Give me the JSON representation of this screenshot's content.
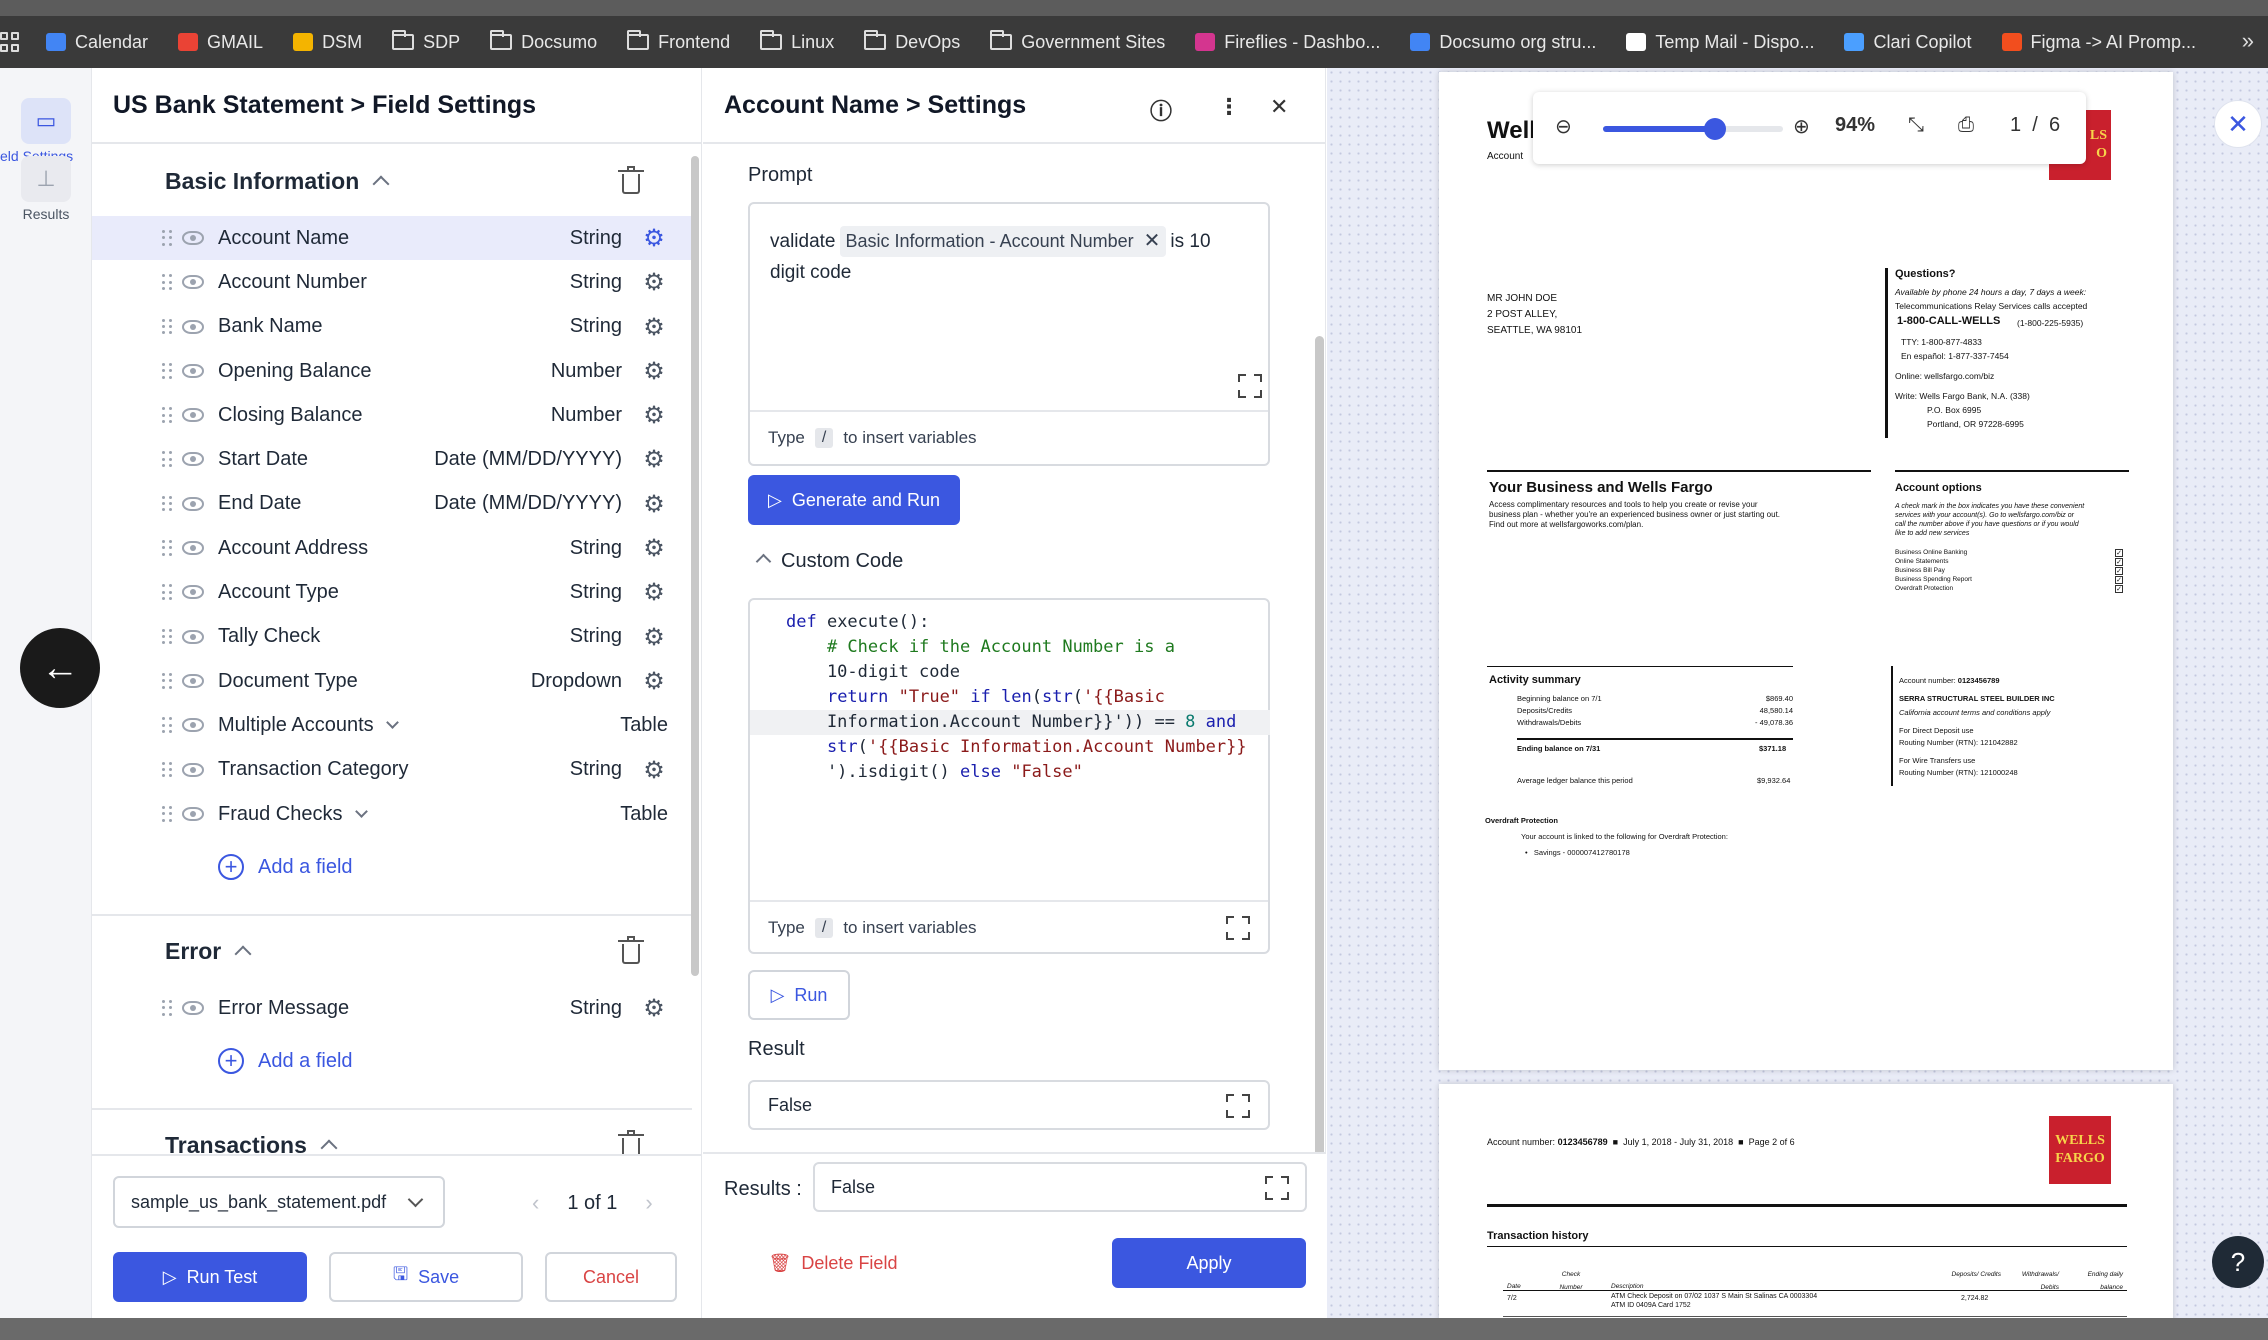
{
  "bookmarks": [
    {
      "label": "Calendar",
      "icon": "calendar-icon",
      "color": "#4285f4"
    },
    {
      "label": "GMAIL",
      "icon": "gmail-icon",
      "color": "#ea4335"
    },
    {
      "label": "DSM",
      "icon": "dsm-icon",
      "color": "#f4b400"
    },
    {
      "label": "SDP",
      "icon": "folder-icon"
    },
    {
      "label": "Docsumo",
      "icon": "folder-icon"
    },
    {
      "label": "Frontend",
      "icon": "folder-icon"
    },
    {
      "label": "Linux",
      "icon": "folder-icon"
    },
    {
      "label": "DevOps",
      "icon": "folder-icon"
    },
    {
      "label": "Government Sites",
      "icon": "folder-icon"
    },
    {
      "label": "Fireflies - Dashbo...",
      "icon": "fireflies-icon",
      "color": "#d4358f"
    },
    {
      "label": "Docsumo org stru...",
      "icon": "docs-icon",
      "color": "#4285f4"
    },
    {
      "label": "Temp Mail - Dispo...",
      "icon": "globe-icon",
      "color": "#ffffff"
    },
    {
      "label": "Clari Copilot",
      "icon": "clari-icon",
      "color": "#4b9fff"
    },
    {
      "label": "Figma -> AI Promp...",
      "icon": "figma-icon",
      "color": "#f24e1e"
    }
  ],
  "rail": {
    "field_settings_label": "eld Settings",
    "results_label": "Results"
  },
  "field_settings": {
    "title": "US Bank Statement > Field Settings",
    "groups": [
      {
        "title": "Basic Information",
        "fields": [
          {
            "name": "Account Name",
            "type": "String",
            "selected": true,
            "gear": true,
            "expandable": false
          },
          {
            "name": "Account Number",
            "type": "String",
            "gear": true,
            "expandable": false
          },
          {
            "name": "Bank Name",
            "type": "String",
            "gear": true,
            "expandable": false
          },
          {
            "name": "Opening Balance",
            "type": "Number",
            "gear": true,
            "expandable": false
          },
          {
            "name": "Closing Balance",
            "type": "Number",
            "gear": true,
            "expandable": false
          },
          {
            "name": "Start Date",
            "type": "Date (MM/DD/YYYY)",
            "gear": true,
            "expandable": false
          },
          {
            "name": "End Date",
            "type": "Date (MM/DD/YYYY)",
            "gear": true,
            "expandable": false
          },
          {
            "name": "Account Address",
            "type": "String",
            "gear": true,
            "expandable": false
          },
          {
            "name": "Account Type",
            "type": "String",
            "gear": true,
            "expandable": false
          },
          {
            "name": "Tally Check",
            "type": "String",
            "gear": true,
            "expandable": false
          },
          {
            "name": "Document Type",
            "type": "Dropdown",
            "gear": true,
            "expandable": false
          },
          {
            "name": "Multiple Accounts",
            "type": "Table",
            "gear": false,
            "expandable": true
          },
          {
            "name": "Transaction Category",
            "type": "String",
            "gear": true,
            "expandable": false
          },
          {
            "name": "Fraud Checks",
            "type": "Table",
            "gear": false,
            "expandable": true
          }
        ],
        "add_label": "Add a field"
      },
      {
        "title": "Error",
        "fields": [
          {
            "name": "Error Message",
            "type": "String",
            "gear": true,
            "expandable": false
          }
        ],
        "add_label": "Add a field"
      },
      {
        "title": "Transactions",
        "fields": [],
        "add_label": ""
      }
    ],
    "footer": {
      "file_name": "sample_us_bank_statement.pdf",
      "pager": "1 of 1",
      "run_test": "Run Test",
      "save": "Save",
      "cancel": "Cancel"
    }
  },
  "settings": {
    "title": "Account Name > Settings",
    "prompt_label": "Prompt",
    "prompt_before": "validate",
    "prompt_chip": "Basic Information - Account Number",
    "prompt_after_1": "is 10",
    "prompt_after_2": "digit code",
    "hint_type": "Type",
    "hint_key": "/",
    "hint_rest": "to insert variables",
    "generate_button": "Generate and Run",
    "custom_code_label": "Custom Code",
    "code_lines": [
      "def execute():",
      "    # Check if the Account Number is a",
      "    10-digit code",
      "    return \"True\" if len(str('{{Basic",
      "    Information.Account Number}}')) == 8 and",
      "    str('{{Basic Information.Account Number}}",
      "    ').isdigit() else \"False\""
    ],
    "run_button": "Run",
    "result_label": "Result",
    "result_value": "False",
    "results_label": "Results :",
    "results_value": "False",
    "delete_button": "Delete Field",
    "apply_button": "Apply"
  },
  "viewer": {
    "zoom": "94%",
    "page_current": "1",
    "page_sep": "/",
    "page_total": "6",
    "zoom_fraction": 0.62
  },
  "document": {
    "page1": {
      "brand_partial": "Well",
      "account_partial": "Account",
      "logo_partial_1": "LS",
      "logo_partial_2": "O",
      "address": [
        "MR JOHN DOE",
        "2 POST ALLEY,",
        "SEATTLE, WA 98101"
      ],
      "questions_title": "Questions?",
      "questions_lines": [
        "Available by phone 24 hours a day, 7 days a week:",
        "Telecommunications Relay Services calls accepted"
      ],
      "phone": "1-800-CALL-WELLS",
      "phone_alt": "(1-800-225-5935)",
      "tty": "TTY: 1-800-877-4833",
      "espanol": "En español: 1-877-337-7454",
      "online": "Online: wellsfargo.com/biz",
      "write": [
        "Write: Wells Fargo Bank, N.A. (338)",
        "P.O. Box 6995",
        "Portland, OR 97228-6995"
      ],
      "your_business_title": "Your Business and Wells Fargo",
      "your_business_text": [
        "Access complimentary resources and tools to help you create or revise your",
        "business plan - whether you're an experienced business owner or just starting out.",
        "Find out more at wellsfargoworks.com/plan."
      ],
      "account_options_title": "Account options",
      "account_options_text": [
        "A check mark in the box indicates you have these convenient",
        "services with your account(s). Go to wellsfargo.com/biz or",
        "call the number above if you have questions or if you would",
        "like to add new services"
      ],
      "account_options_items": [
        "Business Online Banking",
        "Online Statements",
        "Business Bill Pay",
        "Business Spending Report",
        "Overdraft Protection"
      ],
      "activity_title": "Activity summary",
      "activity_rows": [
        {
          "label": "Beginning balance on 7/1",
          "value": "$869.40"
        },
        {
          "label": "Deposits/Credits",
          "value": "48,580.14"
        },
        {
          "label": "Withdrawals/Debits",
          "value": "- 49,078.36"
        }
      ],
      "ending_label": "Ending balance on 7/31",
      "ending_value": "$371.18",
      "avg_label": "Average ledger balance this period",
      "avg_value": "$9,932.64",
      "acct_number_label": "Account number:",
      "acct_number": "0123456789",
      "company": "SERRA STRUCTURAL STEEL BUILDER INC",
      "terms": "California account terms and conditions apply",
      "direct_deposit": "For Direct Deposit use",
      "routing_1": "Routing Number (RTN): 121042882",
      "wire": "For Wire Transfers use",
      "routing_2": "Routing Number (RTN): 121000248",
      "overdraft_title": "Overdraft Protection",
      "overdraft_text": "Your account is linked to the following for Overdraft Protection:",
      "overdraft_item": "Savings - 000007412780178"
    },
    "page2": {
      "header_label": "Account number:",
      "header_account": "0123456789",
      "header_period": "July 1, 2018 - July 31, 2018",
      "header_page": "Page 2 of 6",
      "logo_1": "WELLS",
      "logo_2": "FARGO",
      "section_title": "Transaction history",
      "columns": [
        "Date",
        "Check Number",
        "Description",
        "Deposits/ Credits",
        "Withdrawals/ Debits",
        "Ending daily balance"
      ],
      "row": {
        "date": "7/2",
        "desc_1": "ATM Check Deposit on 07/02 1037 S Main St Salinas CA 0003304",
        "desc_2": "ATM ID 0409A Card 1752",
        "credit": "2,724.82"
      }
    }
  }
}
